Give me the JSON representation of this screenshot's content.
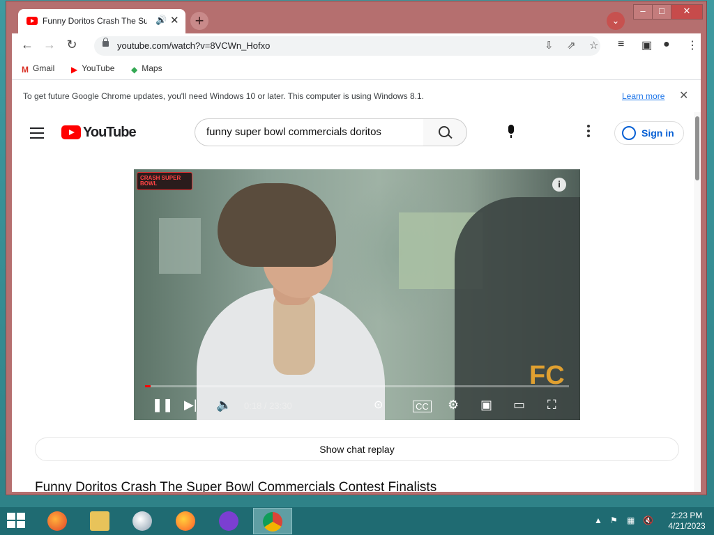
{
  "browser": {
    "tab": {
      "title": "Funny Doritos Crash The Sup",
      "audio_icon": "speaker-icon",
      "close": "✕"
    },
    "new_tab": "+",
    "url": "youtube.com/watch?v=8VCWn_Hofxo",
    "bookmarks": [
      {
        "label": "Gmail",
        "icon": "gmail-icon"
      },
      {
        "label": "YouTube",
        "icon": "youtube-icon"
      },
      {
        "label": "Maps",
        "icon": "maps-icon"
      }
    ],
    "infobar": {
      "message": "To get future Google Chrome updates, you'll need Windows 10 or later. This computer is using Windows 8.1.",
      "link": "Learn more"
    }
  },
  "youtube": {
    "logo_text": "YouTube",
    "search_query": "funny super bowl commercials doritos",
    "signin": "Sign in",
    "player": {
      "time": "0:18 / 23:30",
      "progress_fraction": 0.013,
      "watermark": "CRASH SUPER BOWL",
      "corner_brand": "FC"
    },
    "chat_replay": "Show chat replay",
    "video_title": "Funny Doritos Crash The Super Bowl Commercials Contest Finalists"
  },
  "taskbar": {
    "apps": [
      "firefox-icon",
      "file-explorer-icon",
      "thunderbird-icon",
      "firefox-icon",
      "media-icon",
      "chrome-icon"
    ],
    "time": "2:23 PM",
    "date": "4/21/2023"
  }
}
